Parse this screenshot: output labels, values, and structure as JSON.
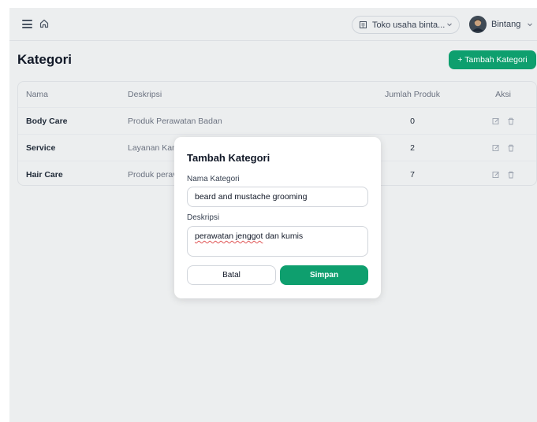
{
  "header": {
    "store_name": "Toko usaha binta...",
    "user_name": "Bintang"
  },
  "page": {
    "title": "Kategori",
    "add_button_label": "+ Tambah Kategori"
  },
  "table": {
    "columns": {
      "name": "Nama",
      "description": "Deskripsi",
      "count": "Jumlah Produk",
      "actions": "Aksi"
    },
    "rows": [
      {
        "name": "Body Care",
        "description": "Produk Perawatan Badan",
        "count": "0"
      },
      {
        "name": "Service",
        "description": "Layanan Kam",
        "count": "2"
      },
      {
        "name": "Hair Care",
        "description": "Produk perav",
        "count": "7"
      }
    ]
  },
  "modal": {
    "title": "Tambah Kategori",
    "name_label": "Nama Kategori",
    "name_value": "beard and mustache grooming",
    "desc_label": "Deskripsi",
    "desc_value_underlined": "perawatan jenggot",
    "desc_value_rest": " dan kumis",
    "cancel_label": "Batal",
    "save_label": "Simpan"
  },
  "icons": {
    "menu": "hamburger-menu-icon",
    "home": "home-icon",
    "store": "store-icon",
    "chevron": "chevron-down-icon",
    "edit": "edit-icon",
    "delete": "trash-icon"
  },
  "colors": {
    "accent": "#0e9f6e",
    "background": "#eceeef",
    "modal_bg": "#ffffff"
  }
}
